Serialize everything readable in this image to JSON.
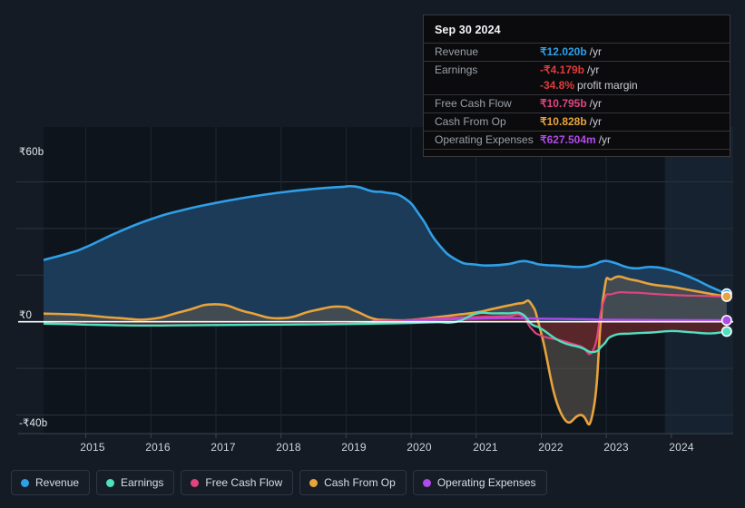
{
  "axes": {
    "y_ticks": [
      {
        "label": "₹60b",
        "value": 60
      },
      {
        "label": "₹0",
        "value": 0
      },
      {
        "label": "-₹40b",
        "value": -40
      }
    ],
    "x_ticks": [
      "2015",
      "2016",
      "2017",
      "2018",
      "2019",
      "2020",
      "2021",
      "2022",
      "2023",
      "2024"
    ]
  },
  "tooltip": {
    "date": "Sep 30 2024",
    "rows": [
      {
        "key": "Revenue",
        "value": "₹12.020b",
        "unit": "/yr",
        "color": "#2f9fe8"
      },
      {
        "key": "Earnings",
        "value": "-₹4.179b",
        "unit": "/yr",
        "color": "#e03b3b"
      },
      {
        "key": "",
        "value": "-34.8%",
        "sub": "profit margin",
        "color": "#e03b3b"
      },
      {
        "key": "Free Cash Flow",
        "value": "₹10.795b",
        "unit": "/yr",
        "color": "#e0457f"
      },
      {
        "key": "Cash From Op",
        "value": "₹10.828b",
        "unit": "/yr",
        "color": "#e8a33d"
      },
      {
        "key": "Operating Expenses",
        "value": "₹627.504m",
        "unit": "/yr",
        "color": "#b04ae8"
      }
    ]
  },
  "legend": [
    {
      "label": "Revenue",
      "color": "#2f9fe8"
    },
    {
      "label": "Earnings",
      "color": "#4fe0c0"
    },
    {
      "label": "Free Cash Flow",
      "color": "#e0457f"
    },
    {
      "label": "Cash From Op",
      "color": "#e8a33d"
    },
    {
      "label": "Operating Expenses",
      "color": "#b04ae8"
    }
  ],
  "chart_data": {
    "type": "area",
    "title": "",
    "xlabel": "",
    "ylabel": "",
    "ylim": [
      -48,
      68
    ],
    "xlim": [
      2014.35,
      2024.95
    ],
    "grid": true,
    "currency": "INR",
    "units": "billions",
    "forecast_start": 2023.9,
    "x": [
      2014.35,
      2014.75,
      2015.0,
      2015.5,
      2016.0,
      2016.5,
      2017.0,
      2017.5,
      2018.0,
      2018.5,
      2018.9,
      2019.15,
      2019.4,
      2019.6,
      2019.9,
      2020.15,
      2020.4,
      2020.7,
      2021.0,
      2021.25,
      2021.5,
      2021.7,
      2021.85,
      2022.0,
      2022.3,
      2022.6,
      2022.8,
      2022.95,
      2023.1,
      2023.4,
      2023.7,
      2024.0,
      2024.3,
      2024.6,
      2024.85
    ],
    "series": [
      {
        "name": "Revenue",
        "color": "#2f9fe8",
        "fill": "#1b3b58",
        "values": [
          26.5,
          29.5,
          32.0,
          38.5,
          44.0,
          48.0,
          51.0,
          53.5,
          55.5,
          57.0,
          57.8,
          58.0,
          56.0,
          55.5,
          53.0,
          45.0,
          34.0,
          26.5,
          24.5,
          24.2,
          24.8,
          26.0,
          25.5,
          24.5,
          24.0,
          23.5,
          24.5,
          26.0,
          25.5,
          23.0,
          23.5,
          22.0,
          19.0,
          15.0,
          12.02
        ]
      },
      {
        "name": "Earnings",
        "color": "#4fe0c0",
        "fill": "#5e2328",
        "values": [
          -0.8,
          -1.0,
          -1.2,
          -1.5,
          -1.6,
          -1.5,
          -1.4,
          -1.3,
          -1.2,
          -1.1,
          -1.0,
          -0.9,
          -0.8,
          -0.7,
          -0.6,
          -0.4,
          -0.2,
          0.0,
          3.5,
          3.6,
          3.6,
          3.4,
          -1.0,
          -3.0,
          -8.5,
          -11.0,
          -13.0,
          -10.0,
          -6.0,
          -5.0,
          -4.6,
          -4.0,
          -4.5,
          -5.0,
          -4.179
        ]
      },
      {
        "name": "Free Cash Flow",
        "color": "#e0457f",
        "fill": "none",
        "values": [
          null,
          null,
          null,
          null,
          null,
          null,
          null,
          null,
          null,
          null,
          null,
          null,
          0.2,
          0.4,
          0.6,
          1.0,
          1.4,
          1.8,
          2.0,
          2.2,
          2.4,
          2.6,
          -3.0,
          -6.0,
          -8.0,
          -10.5,
          -12.0,
          8.0,
          12.0,
          12.5,
          12.0,
          11.5,
          11.2,
          11.0,
          10.795
        ]
      },
      {
        "name": "Cash From Op",
        "color": "#e8a33d",
        "fill": "#5a564d",
        "values": [
          3.5,
          3.2,
          2.8,
          1.6,
          1.2,
          4.5,
          7.5,
          4.0,
          1.5,
          4.8,
          6.5,
          4.5,
          1.5,
          0.8,
          0.6,
          1.2,
          2.0,
          3.0,
          4.0,
          5.5,
          7.0,
          8.0,
          7.5,
          -5.0,
          -39.0,
          -40.0,
          -38.0,
          10.0,
          18.5,
          18.0,
          16.0,
          15.0,
          13.5,
          12.0,
          10.828
        ]
      },
      {
        "name": "Operating Expenses",
        "color": "#b04ae8",
        "fill": "none",
        "values": [
          null,
          null,
          null,
          null,
          null,
          null,
          null,
          null,
          null,
          null,
          null,
          null,
          null,
          null,
          0.5,
          0.7,
          0.9,
          1.1,
          1.3,
          1.5,
          1.6,
          1.5,
          1.4,
          1.3,
          1.2,
          1.1,
          1.0,
          0.9,
          0.85,
          0.8,
          0.75,
          0.72,
          0.7,
          0.66,
          0.6275
        ]
      }
    ]
  }
}
